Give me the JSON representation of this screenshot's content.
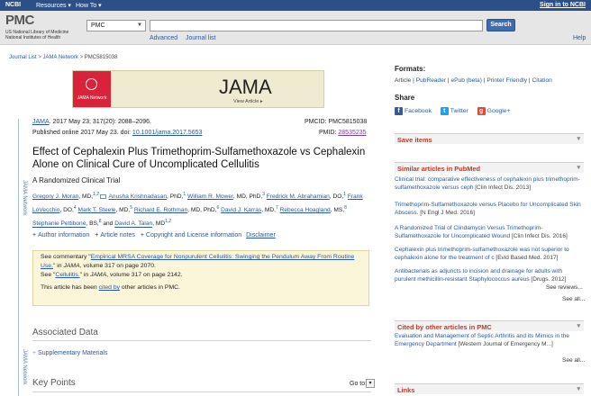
{
  "topbar": {
    "ncbi": "NCBI",
    "resources": "Resources",
    "howto": "How To",
    "signin": "Sign in to NCBI"
  },
  "header": {
    "logo": "PMC",
    "logo_sub1": "US National Library of Medicine",
    "logo_sub2": "National Institutes of Health",
    "db_value": "PMC",
    "search_value": "",
    "search_button": "Search",
    "advanced": "Advanced",
    "journal_list": "Journal list",
    "help": "Help"
  },
  "breadcrumb": {
    "items": [
      "Journal List",
      "JAMA Network",
      "PMC5815038"
    ],
    "sep": ">"
  },
  "banner": {
    "network": "JAMA Network",
    "journal": "JAMA",
    "view": "View Article ▸"
  },
  "article": {
    "journal": "JAMA",
    "citation": ". 2017 May 23; 317(20): 2088–2096.",
    "published": "Published online 2017 May 23. doi: ",
    "doi": "10.1001/jama.2017.5653",
    "pmcid_label": "PMCID: PMC5815038",
    "pmid_label": "PMID: ",
    "pmid": "28535235",
    "title": "Effect of Cephalexin Plus Trimethoprim-Sulfamethoxazole vs Cephalexin Alone on Clinical Cure of Uncomplicated Cellulitis",
    "subtitle": "A Randomized Clinical Trial",
    "authors": [
      {
        "name": "Gregory J. Moran",
        "deg": ", MD,",
        "sup": "1,2",
        "mail": true
      },
      {
        "name": "Anusha Krishnadasan",
        "deg": ", PhD,",
        "sup": "1",
        "mail": false
      },
      {
        "name": "William R. Mower",
        "deg": ", MD, PhD,",
        "sup": "3",
        "mail": false
      },
      {
        "name": "Fredrick M. Abrahamian",
        "deg": ", DO,",
        "sup": "1",
        "mail": false
      },
      {
        "name": "Frank LoVecchio",
        "deg": ", DO,",
        "sup": "4",
        "mail": false
      },
      {
        "name": "Mark T. Steele",
        "deg": ", MD,",
        "sup": "5",
        "mail": false
      },
      {
        "name": "Richard E. Rothman",
        "deg": ", MD, PhD,",
        "sup": "6",
        "mail": false
      },
      {
        "name": "David J. Karras",
        "deg": ", MD,",
        "sup": "7",
        "mail": false
      },
      {
        "name": "Rebecca Hoagland",
        "deg": ", MS,",
        "sup": "8",
        "mail": false
      },
      {
        "name": "Stephanie Pettibone",
        "deg": ", BS,",
        "sup": "8",
        "mail": false
      },
      {
        "name": "David A. Talan",
        "deg": ", MD",
        "sup": "1,2",
        "mail": false
      }
    ],
    "and_word": "and",
    "info_links": [
      "Author information",
      "Article notes",
      "Copyright and License information",
      "Disclaimer"
    ],
    "notice": {
      "l1_pre": "See commentary \"",
      "l1_link": "Empirical MRSA Coverage for Nonpurulent Cellulitis: Swinging the Pendulum Away From Routine Use.",
      "l1_post": "\" in ",
      "l1_journal": "JAMA",
      "l1_end": ", volume 317 on page 2070.",
      "l2_pre": "See \"",
      "l2_link": "Cellulitis.",
      "l2_post": "\" in ",
      "l2_journal": "JAMA",
      "l2_end": ", volume 317 on page 2142.",
      "l3_pre": "This article has been ",
      "l3_link": "cited by",
      "l3_end": " other articles in PMC."
    },
    "vertical_label": "JAMA Network",
    "associated_data": "Associated Data",
    "supplementary": "Supplementary Materials",
    "key_points": "Key Points",
    "goto": "Go to:"
  },
  "sidebar": {
    "formats_title": "Formats:",
    "formats": [
      "Article",
      "PubReader",
      "ePub (beta)",
      "Printer Friendly",
      "Citation"
    ],
    "share_title": "Share",
    "share": [
      "Facebook",
      "Twitter",
      "Google+"
    ],
    "save_items": "Save items",
    "similar_title": "Similar articles in PubMed",
    "similar": [
      {
        "text": "Clinical trial: comparative effectiveness of cephalexin plus trimethoprim-sulfamethoxazole versus ceph",
        "src": "[Clin Infect Dis. 2013]"
      },
      {
        "text": "Trimethoprim-Sulfamethoxazole versus Placebo for Uncomplicated Skin Abscess.",
        "src": "[N Engl J Med. 2016]"
      },
      {
        "text": "A Randomized Trial of Clindamycin Versus Trimethoprim-Sulfamethoxazole for Uncomplicated Wound",
        "src": "[Clin Infect Dis. 2016]"
      },
      {
        "text": "Cephalexin plus trimethoprim-sulfamethoxazole was not superior to cephalexin alone for the treatment of c",
        "src": "[Evid Based Med. 2017]"
      },
      {
        "text": "Antibacterials as adjuncts to incision and drainage for adults with purulent methicillin-resistant Staphylococcus aureus",
        "src": "[Drugs. 2012]"
      }
    ],
    "see_reviews": "See reviews...",
    "see_all": "See all...",
    "cited_title": "Cited by other articles in PMC",
    "cited": [
      {
        "text": "Evaluation and Management of Septic Arthritis and its Mimics in the Emergency Department",
        "src": "[Western Journal of Emergency M...]"
      }
    ],
    "links_title": "Links"
  },
  "colors": {
    "accent": "#2a57a4",
    "topbar": "#2b4f86",
    "section_red": "#c0392b",
    "jama_red": "#d9233a",
    "notice_bg": "#fbf6da"
  }
}
